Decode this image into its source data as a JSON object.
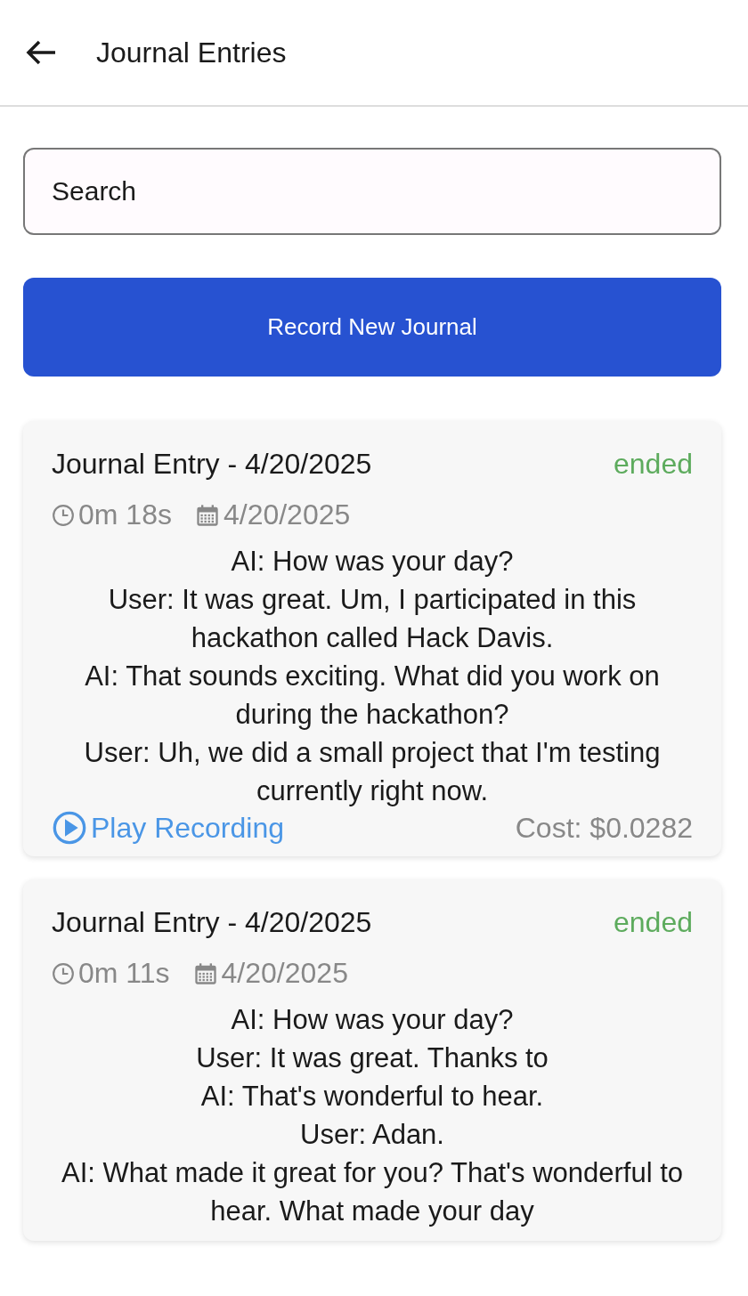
{
  "header": {
    "title": "Journal Entries"
  },
  "search": {
    "placeholder": "Search"
  },
  "record_button": {
    "label": "Record New Journal"
  },
  "entries": [
    {
      "title": "Journal Entry - 4/20/2025",
      "status": "ended",
      "duration": "0m 18s",
      "date": "4/20/2025",
      "transcript": [
        "AI: How was your day?",
        "User: It was great. Um, I participated in this hackathon called Hack Davis.",
        "AI: That sounds exciting. What did you work on during the hackathon?",
        "User: Uh, we did a small project that I'm testing currently right now."
      ],
      "play_label": "Play Recording",
      "cost": "Cost: $0.0282"
    },
    {
      "title": "Journal Entry - 4/20/2025",
      "status": "ended",
      "duration": "0m 11s",
      "date": "4/20/2025",
      "transcript": [
        "AI: How was your day?",
        "User: It was great. Thanks to",
        "AI: That's wonderful to hear.",
        "User: Adan.",
        "AI: What made it great for you? That's wonderful to hear. What made your day"
      ]
    }
  ]
}
